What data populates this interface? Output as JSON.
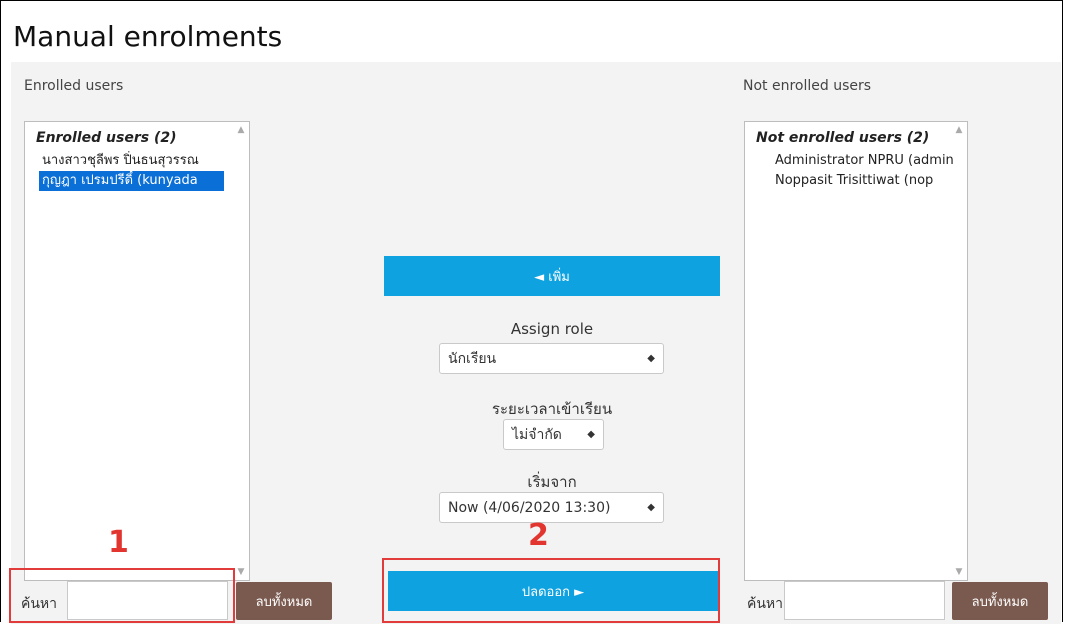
{
  "page": {
    "title": "Manual enrolments"
  },
  "enrolled": {
    "heading": "Enrolled users",
    "group_label": "Enrolled users (2)",
    "items": [
      "นางสาวชุลีพร ปิ่นธนสุวรรณ",
      "กุญฎา เปรมปรีดิ์ (kunyada"
    ],
    "selected_index": 1,
    "search_label": "ค้นหา",
    "search_value": "",
    "clear_label": "ลบทั้งหมด"
  },
  "not_enrolled": {
    "heading": "Not enrolled users",
    "group_label": "Not enrolled users (2)",
    "items": [
      "Administrator NPRU (admin",
      "Noppasit Trisittiwat (nop"
    ],
    "search_label": "ค้นหา",
    "search_value": "",
    "clear_label": "ลบทั้งหมด"
  },
  "controls": {
    "add_label": "◄ เพิ่ม",
    "remove_label": "ปลดออก ►",
    "assign_role_label": "Assign role",
    "assign_role_value": "นักเรียน",
    "duration_label": "ระยะเวลาเข้าเรียน",
    "duration_value": "ไม่จำกัด",
    "start_label": "เริ่มจาก",
    "start_value": "Now (4/06/2020 13:30)"
  },
  "annotations": {
    "marker1": "1",
    "marker2": "2"
  },
  "colors": {
    "primary_button": "#0fa2e0",
    "secondary_button": "#7a5a4f",
    "selection": "#0a6fd6",
    "annotation": "#e23b3b"
  }
}
